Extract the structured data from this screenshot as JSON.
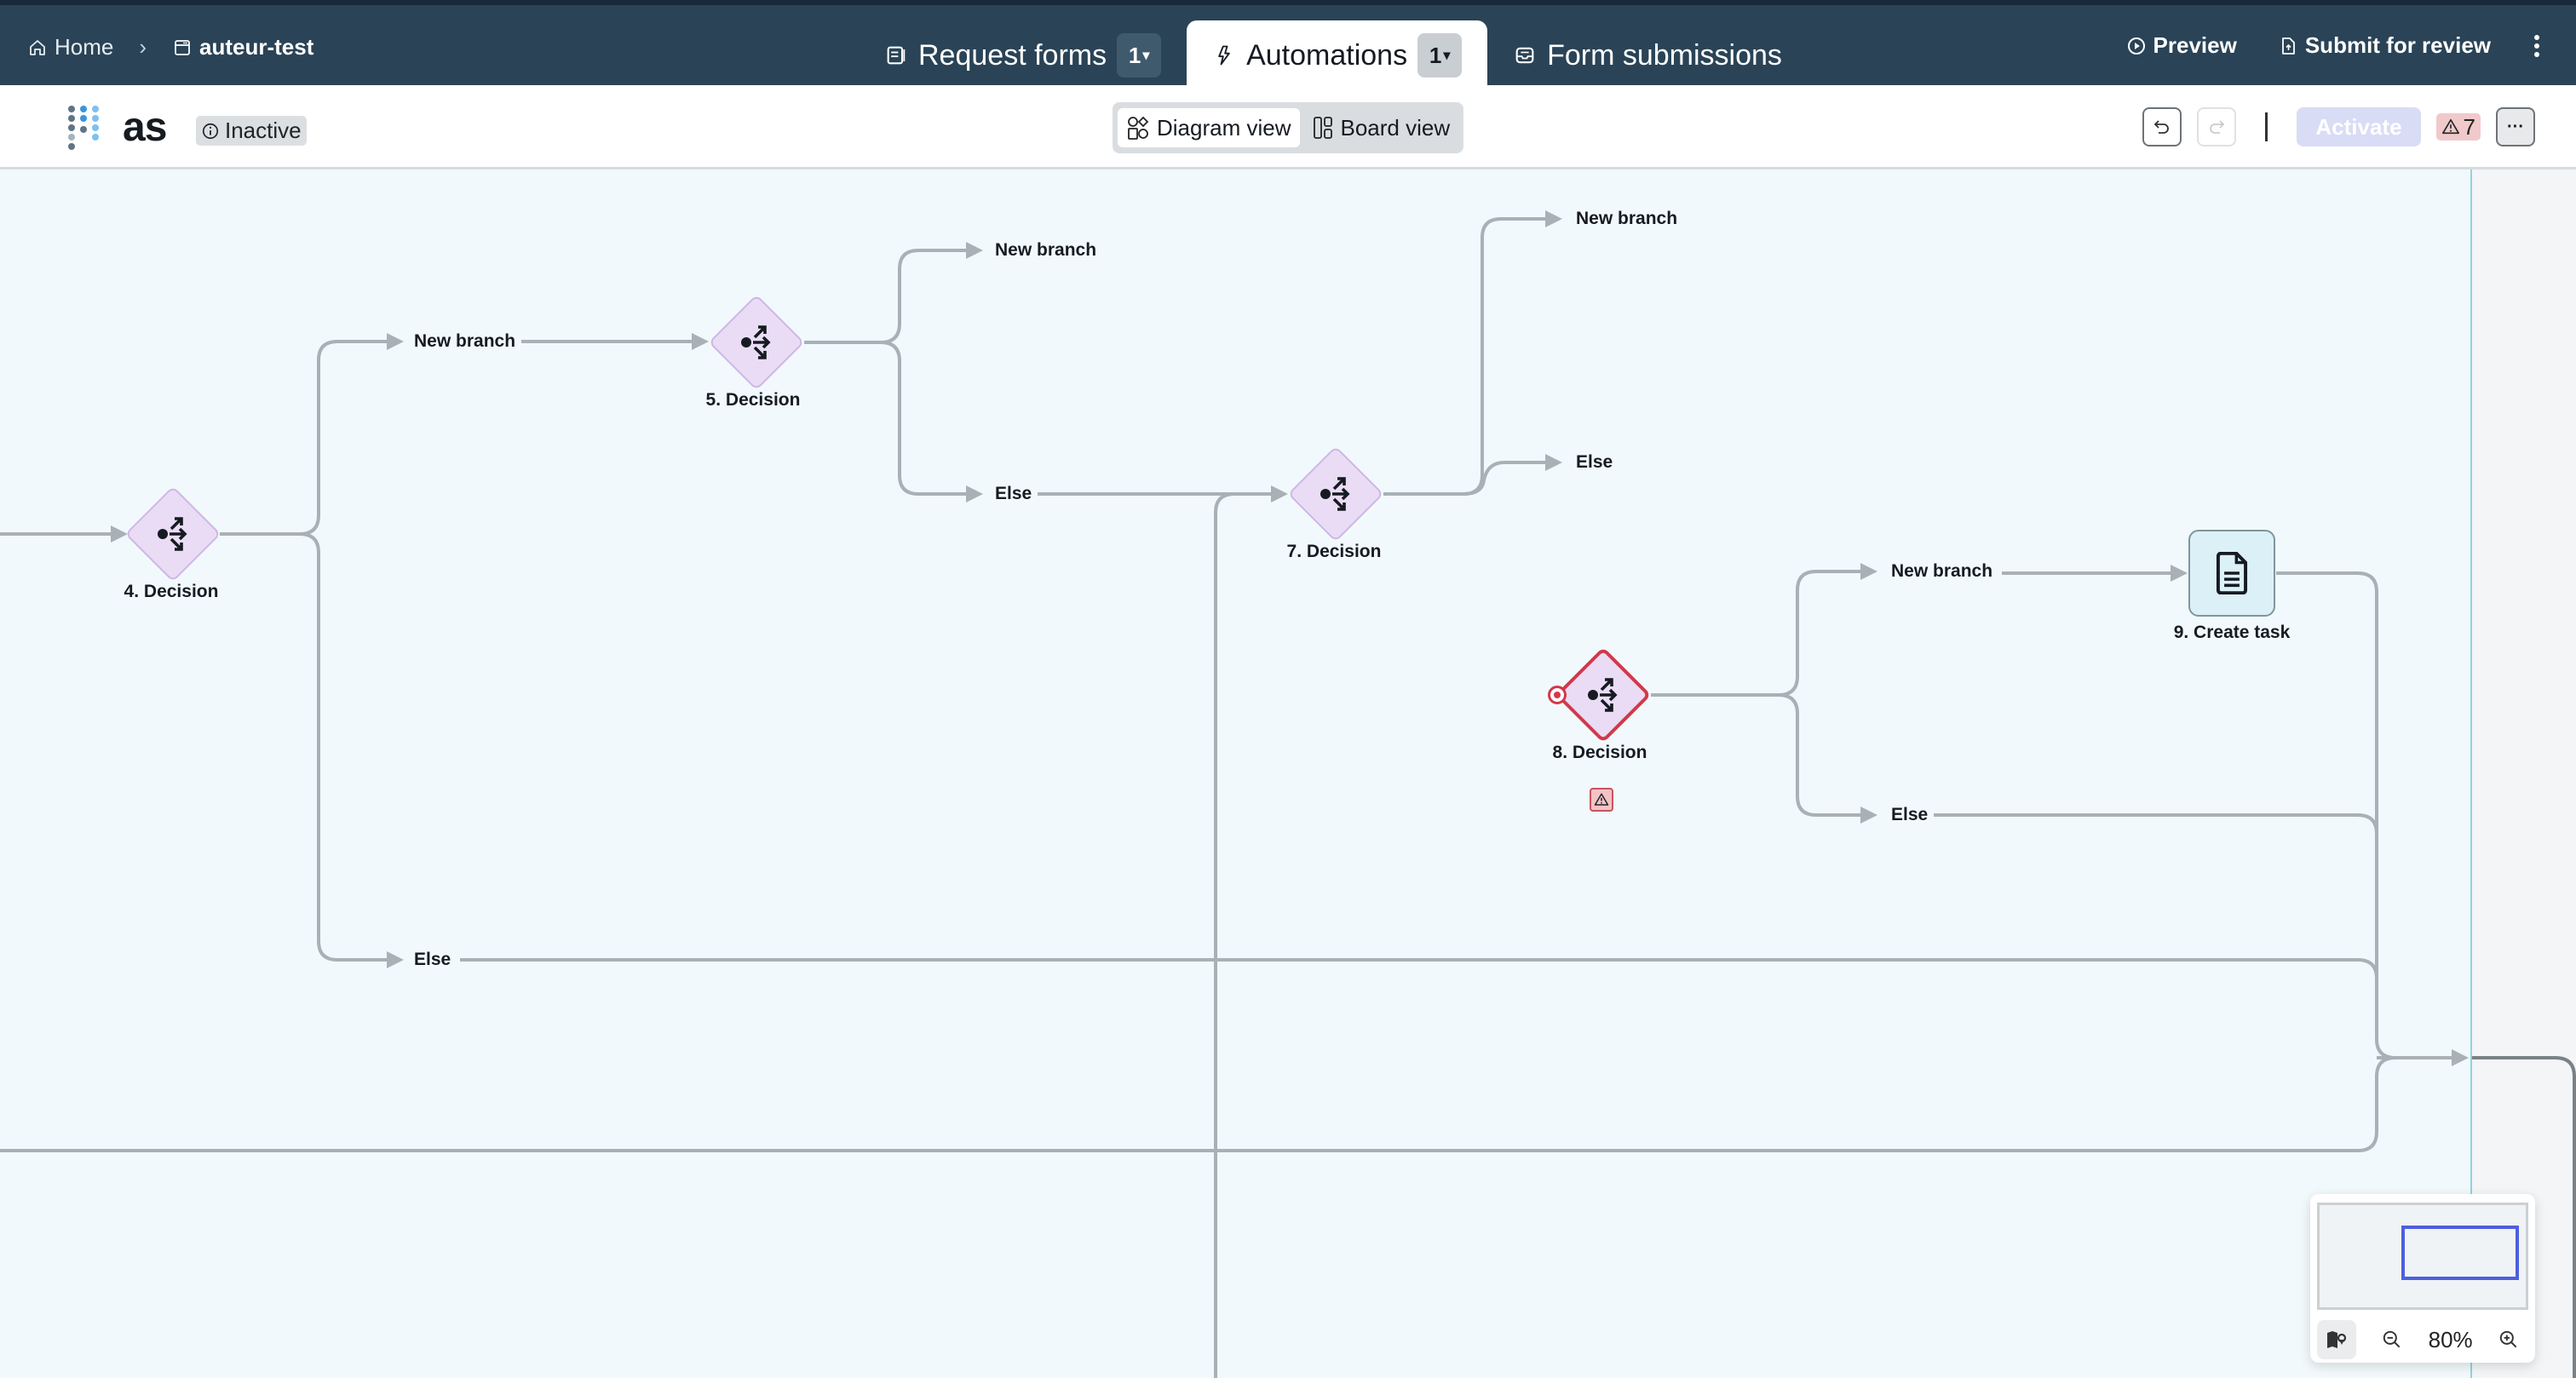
{
  "header": {
    "breadcrumb": [
      {
        "label": "Home",
        "icon": "home-icon"
      },
      {
        "label": "auteur-test",
        "icon": "app-window-icon"
      }
    ],
    "tabs": [
      {
        "label": "Request forms",
        "count": "1",
        "icon": "form-icon",
        "active": false
      },
      {
        "label": "Automations",
        "count": "1",
        "icon": "bolt-icon",
        "active": true
      },
      {
        "label": "Form submissions",
        "icon": "inbox-icon",
        "active": false
      }
    ],
    "actions": {
      "preview": "Preview",
      "submit": "Submit for review",
      "more": "more-vertical-icon"
    }
  },
  "toolbar": {
    "automation_name": "as",
    "status": "Inactive",
    "views": {
      "diagram": "Diagram view",
      "board": "Board view",
      "active": "diagram"
    },
    "activate": "Activate",
    "warning_count": "7",
    "more": "···"
  },
  "diagram": {
    "nodes": [
      {
        "id": "4",
        "label": "4. Decision",
        "type": "decision",
        "error": false
      },
      {
        "id": "5",
        "label": "5. Decision",
        "type": "decision",
        "error": false
      },
      {
        "id": "7",
        "label": "7. Decision",
        "type": "decision",
        "error": false
      },
      {
        "id": "8",
        "label": "8. Decision",
        "type": "decision",
        "error": true
      },
      {
        "id": "9",
        "label": "9. Create task",
        "type": "task",
        "error": false
      }
    ],
    "branches": {
      "d4_new": "New branch",
      "d4_else": "Else",
      "d5_new": "New branch",
      "d5_else": "Else",
      "d7_new": "New branch",
      "d7_else": "Else",
      "d8_new": "New branch",
      "d8_else": "Else"
    }
  },
  "minimap": {
    "zoom_level": "80%"
  },
  "colors": {
    "header_bg": "#2a4356",
    "decision_fill": "#eadcf5",
    "error": "#d2384a",
    "task_fill": "#dcf0f7",
    "edge": "#a9b1b6",
    "minimap_viewport": "#4c5fe0"
  }
}
